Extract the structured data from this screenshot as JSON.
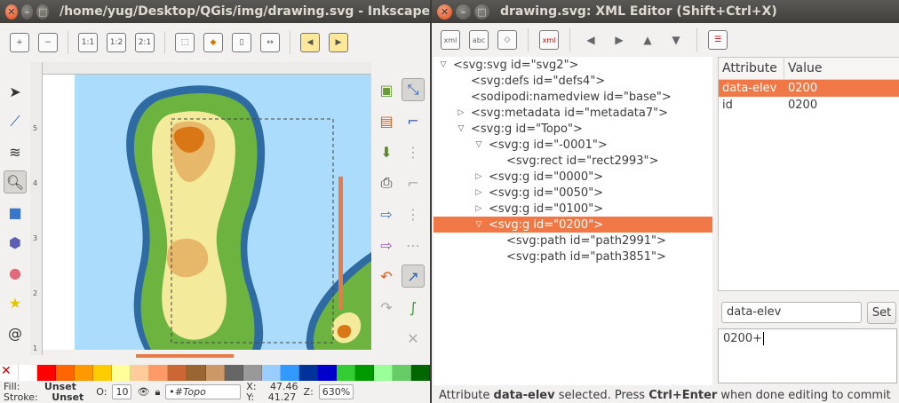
{
  "inkscape": {
    "title": "/home/yug/Desktop/QGis/img/drawing.svg - Inkscape",
    "toolbar_icons": [
      "zoom-in-icon",
      "zoom-out-icon",
      "zoom-1-1-icon",
      "zoom-1-2-icon",
      "zoom-2-1-icon",
      "zoom-selection-icon",
      "zoom-drawing-icon",
      "zoom-page-icon",
      "zoom-width-icon",
      "zoom-prev-icon",
      "zoom-next-icon"
    ],
    "toolbar_labels": {
      "z11": "1:1",
      "z12": "1:2",
      "z21": "2:1"
    },
    "status": {
      "fill_label": "Fill:",
      "fill_value": "Unset",
      "stroke_label": "Stroke:",
      "stroke_value": "Unset",
      "opacity_label": "O:",
      "opacity_value": "10",
      "layer_value": "•#Topo",
      "x_label": "X:",
      "x_value": "47.46",
      "y_label": "Y:",
      "y_value": "41.27",
      "zoom_label": "Z:",
      "zoom_value": "630%"
    },
    "ruler_marks": [
      "5",
      "4",
      "3",
      "2",
      "1"
    ],
    "palette": [
      "#ffffff",
      "#ff0000",
      "#ff6600",
      "#ff9900",
      "#ffcc00",
      "#ffff99",
      "#ffcc99",
      "#ff9966",
      "#cc6633",
      "#996633",
      "#cc9966",
      "#666666",
      "#999999",
      "#99ccff",
      "#3399ff",
      "#003399",
      "#0000cc",
      "#33cc33",
      "#009900",
      "#99ff99",
      "#66cc66",
      "#006600"
    ]
  },
  "xml_editor": {
    "title": "drawing.svg: XML Editor (Shift+Ctrl+X)",
    "toolbar_labels": {
      "new_element": "xml",
      "new_text": "abc",
      "delete_node": "xml"
    },
    "tree": [
      {
        "label": "<svg:svg id=\"svg2\">",
        "indent": 0,
        "expander": "▽",
        "selected": false
      },
      {
        "label": "<svg:defs id=\"defs4\">",
        "indent": 1,
        "expander": "",
        "selected": false
      },
      {
        "label": "<sodipodi:namedview id=\"base\">",
        "indent": 1,
        "expander": "",
        "selected": false
      },
      {
        "label": "<svg:metadata id=\"metadata7\">",
        "indent": 1,
        "expander": "▷",
        "selected": false
      },
      {
        "label": "<svg:g id=\"Topo\">",
        "indent": 1,
        "expander": "▽",
        "selected": false
      },
      {
        "label": "<svg:g id=\"-0001\">",
        "indent": 2,
        "expander": "▽",
        "selected": false
      },
      {
        "label": "<svg:rect id=\"rect2993\">",
        "indent": 3,
        "expander": "",
        "selected": false
      },
      {
        "label": "<svg:g id=\"0000\">",
        "indent": 2,
        "expander": "▷",
        "selected": false
      },
      {
        "label": "<svg:g id=\"0050\">",
        "indent": 2,
        "expander": "▷",
        "selected": false
      },
      {
        "label": "<svg:g id=\"0100\">",
        "indent": 2,
        "expander": "▷",
        "selected": false
      },
      {
        "label": "<svg:g id=\"0200\">",
        "indent": 2,
        "expander": "▽",
        "selected": true
      },
      {
        "label": "<svg:path id=\"path2991\">",
        "indent": 3,
        "expander": "",
        "selected": false
      },
      {
        "label": "<svg:path id=\"path3851\">",
        "indent": 3,
        "expander": "",
        "selected": false
      }
    ],
    "attributes": {
      "col_attribute": "Attribute",
      "col_value": "Value",
      "rows": [
        {
          "name": "data-elev",
          "value": "0200",
          "selected": true
        },
        {
          "name": "id",
          "value": "0200",
          "selected": false
        }
      ]
    },
    "name_field_value": "data-elev",
    "set_label": "Set",
    "value_field_value": "0200+",
    "status_prefix": "Attribute ",
    "status_attr": "data-elev",
    "status_mid": " selected. Press ",
    "status_key": "Ctrl+Enter",
    "status_suffix": " when done editing to commit"
  }
}
